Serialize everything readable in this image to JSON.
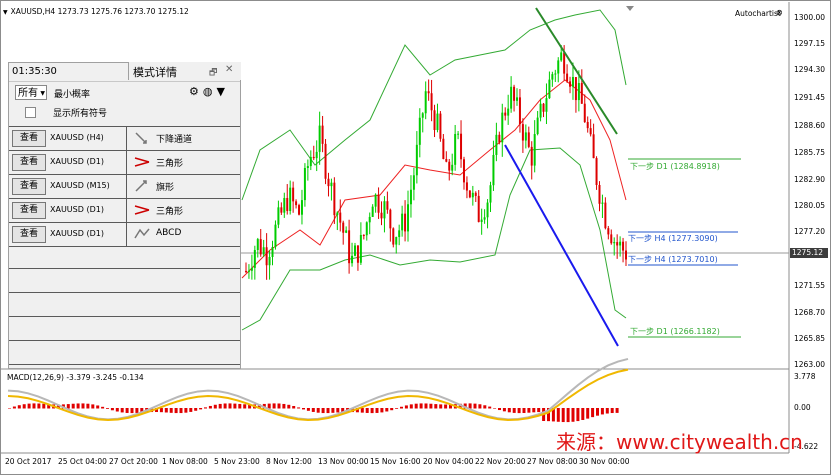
{
  "chart": {
    "symbol_header": "XAUUSD,H4  1273.73 1275.76 1273.70 1275.12",
    "autochartist_label": "Autochartist",
    "current_price": "1275.12",
    "price_axis": [
      "1300.00",
      "1297.15",
      "1294.30",
      "1291.45",
      "1288.60",
      "1285.75",
      "1282.90",
      "1280.05",
      "1277.20",
      "1274.40",
      "1271.55",
      "1268.70",
      "1265.85",
      "1263.00"
    ],
    "time_axis": [
      "20 Oct 2017",
      "25 Oct 04:00",
      "27 Oct 20:00",
      "1 Nov 08:00",
      "5 Nov 23:00",
      "8 Nov 12:00",
      "13 Nov 00:00",
      "15 Nov 16:00",
      "20 Nov 04:00",
      "22 Nov 20:00",
      "27 Nov 08:00",
      "30 Nov 00:00"
    ],
    "next_steps": [
      {
        "label": "下一步 D1 (1284.8918)",
        "color": "#33aa33"
      },
      {
        "label": "下一步 H4 (1277.3090)",
        "color": "#2255cc"
      },
      {
        "label": "下一步 H4 (1273.7010)",
        "color": "#2255cc"
      },
      {
        "label": "下一步 D1 (1266.1182)",
        "color": "#33aa33"
      }
    ],
    "macd_label": "MACD(12,26,9) -3.379 -3.245 -0.134",
    "macd_axis": [
      "3.778",
      "0.00",
      "-4.622"
    ],
    "watermark": "来源：www.citywealth.cn",
    "colors": {
      "bull": "#00cc00",
      "bear": "#dd0000",
      "bands": "#33aa33",
      "ma": "#ee2222",
      "channel_top": "#2a8a2a",
      "channel_bottom": "#1a1aee"
    }
  },
  "panel": {
    "time": "01:35:30",
    "title": "模式详情",
    "filter_value": "所有",
    "probability_label": "最小概率",
    "show_all_label": "显示所有符号",
    "view_label": "查看",
    "rows": [
      {
        "symbol": "XAUUSD (H4)",
        "pattern": "下降通道",
        "icon": "channel-down-icon"
      },
      {
        "symbol": "XAUUSD (D1)",
        "pattern": "三角形",
        "icon": "triangle-icon"
      },
      {
        "symbol": "XAUUSD (M15)",
        "pattern": "旗形",
        "icon": "flag-icon"
      },
      {
        "symbol": "XAUUSD (D1)",
        "pattern": "三角形",
        "icon": "triangle-icon"
      },
      {
        "symbol": "XAUUSD (D1)",
        "pattern": "ABCD",
        "icon": "abcd-icon"
      }
    ]
  }
}
